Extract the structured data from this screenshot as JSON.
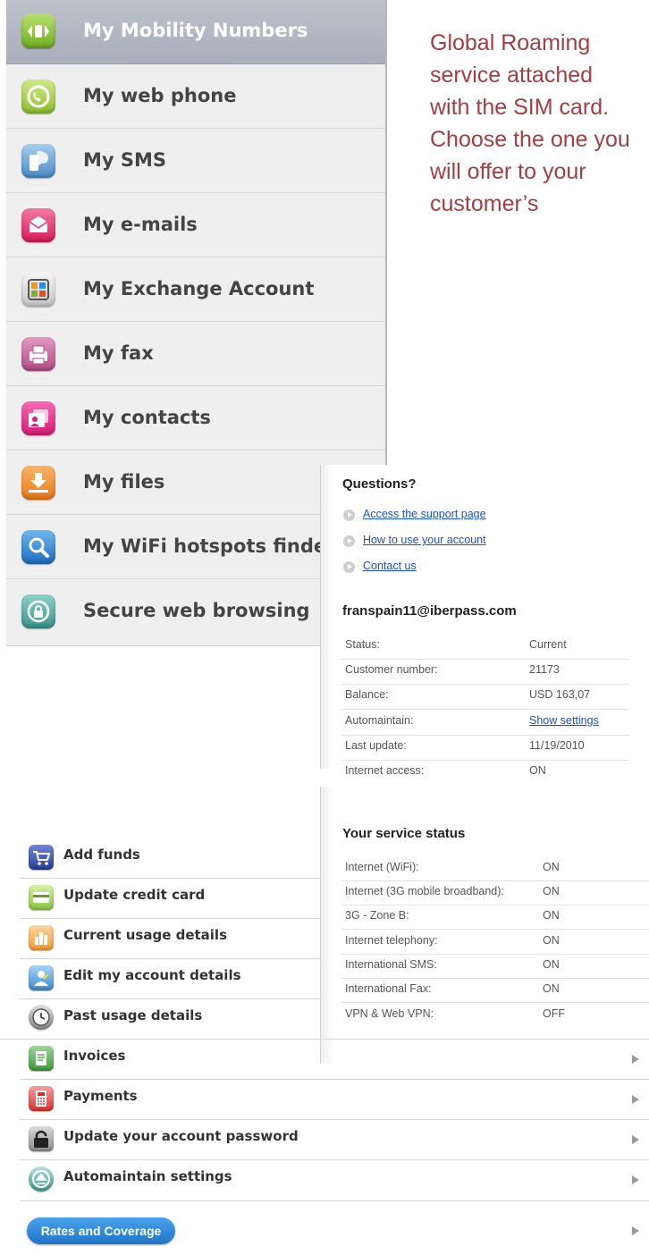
{
  "top_menu": {
    "items": [
      {
        "label": "My Mobility Numbers",
        "icon": "phone-arrows-icon",
        "color": "#8cc63f",
        "active": true
      },
      {
        "label": "My web phone",
        "icon": "web-phone-icon",
        "color": "#9ccc3c"
      },
      {
        "label": "My SMS",
        "icon": "sms-phone-icon",
        "color": "#5b9fd6"
      },
      {
        "label": "My e-mails",
        "icon": "envelope-icon",
        "color": "#e8336e"
      },
      {
        "label": "My Exchange Account",
        "icon": "exchange-icon",
        "color": "#d9d9d9"
      },
      {
        "label": "My fax",
        "icon": "fax-icon",
        "color": "#c35c92"
      },
      {
        "label": "My contacts",
        "icon": "contacts-icon",
        "color": "#e0338b"
      },
      {
        "label": "My files",
        "icon": "download-icon",
        "color": "#f08a24"
      },
      {
        "label": "My WiFi hotspots finder",
        "icon": "magnifier-icon",
        "color": "#2d86d0"
      },
      {
        "label": "Secure web browsing",
        "icon": "lock-icon",
        "color": "#4fa8a0"
      }
    ]
  },
  "promo_text": "Global Roaming service attached with the SIM card. Choose the one you will offer to your customer’s",
  "questions": {
    "title": "Questions?",
    "links": [
      "Access the support page",
      "How to use your account",
      "Contact us"
    ]
  },
  "account": {
    "email": "franspain11@iberpass.com",
    "rows": [
      {
        "key": "Status:",
        "value": "Current"
      },
      {
        "key": "Customer number:",
        "value": "21173"
      },
      {
        "key": "Balance:",
        "value": "USD 163,07"
      },
      {
        "key": "Automaintain:",
        "value": "Show settings",
        "link": true
      },
      {
        "key": "Last update:",
        "value": "11/19/2010"
      },
      {
        "key": "Internet access:",
        "value": "ON"
      }
    ]
  },
  "service_status": {
    "title": "Your service status",
    "rows": [
      {
        "key": "Internet (WiFi):",
        "value": "ON"
      },
      {
        "key": "Internet (3G mobile broadband):",
        "value": "ON"
      },
      {
        "key": "3G - Zone B:",
        "value": "ON"
      },
      {
        "key": "Internet telephony:",
        "value": "ON"
      },
      {
        "key": "International SMS:",
        "value": "ON"
      },
      {
        "key": "International Fax:",
        "value": "ON"
      },
      {
        "key": "VPN & Web VPN:",
        "value": "OFF"
      }
    ]
  },
  "bottom_menu": {
    "items": [
      {
        "label": "Add funds",
        "icon": "cart-icon"
      },
      {
        "label": "Update credit card",
        "icon": "credit-card-icon"
      },
      {
        "label": "Current usage details",
        "icon": "bar-chart-icon"
      },
      {
        "label": "Edit my account details",
        "icon": "account-edit-icon"
      },
      {
        "label": "Past usage details",
        "icon": "clock-icon"
      },
      {
        "label": "Invoices",
        "icon": "invoice-icon"
      },
      {
        "label": "Payments",
        "icon": "calculator-icon"
      },
      {
        "label": "Update your account password",
        "icon": "padlock-icon"
      },
      {
        "label": "Automaintain settings",
        "icon": "settings-arrows-icon"
      }
    ],
    "rates_button": "Rates and Coverage"
  }
}
